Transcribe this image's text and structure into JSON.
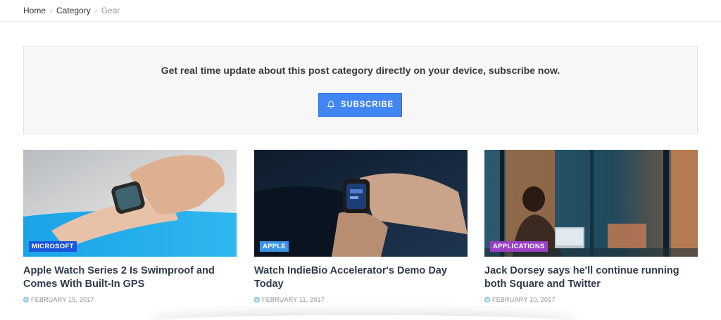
{
  "breadcrumb": {
    "home": "Home",
    "category": "Category",
    "current": "Gear",
    "separator": "›"
  },
  "subscribe": {
    "text": "Get real time update about this post category directly on your device, subscribe now.",
    "button_label": "SUBSCRIBE",
    "button_icon": "bell-icon",
    "button_color": "#4285f4"
  },
  "posts": [
    {
      "category": "MICROSOFT",
      "category_color": "#1a56db",
      "title": "Apple Watch Series 2 Is Swimproof and Comes With Built-In GPS",
      "date": "FEBRUARY 15, 2017"
    },
    {
      "category": "APPLE",
      "category_color": "#3b93e6",
      "title": "Watch IndieBio Accelerator's Demo Day Today",
      "date": "FEBRUARY 11, 2017"
    },
    {
      "category": "APPLICATIONS",
      "category_color": "#9b3fc7",
      "title": "Jack Dorsey says he'll continue running both Square and Twitter",
      "date": "FEBRUARY 10, 2017"
    }
  ]
}
